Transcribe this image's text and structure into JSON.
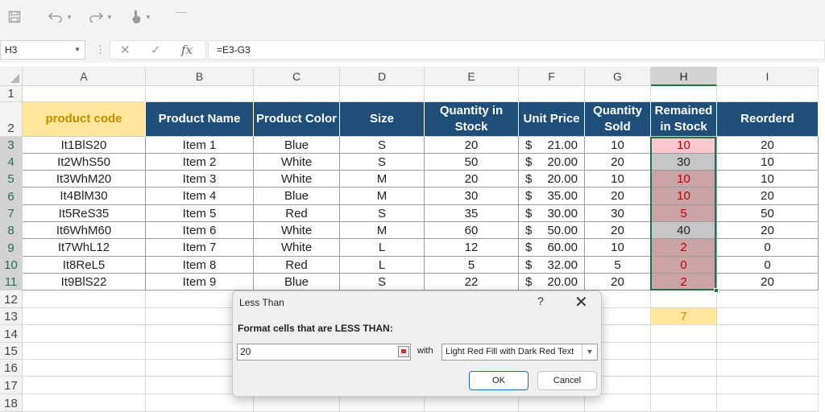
{
  "toolbar": {
    "save_icon": "floppy-disk-icon",
    "undo_icon": "undo-icon",
    "redo_icon": "redo-icon",
    "touch_icon": "touch-mode-icon"
  },
  "formula_bar": {
    "name_box": "H3",
    "formula": "=E3-G3",
    "fx_label": "fx"
  },
  "columns": [
    "A",
    "B",
    "C",
    "D",
    "E",
    "F",
    "G",
    "H",
    "I"
  ],
  "selected_column": "H",
  "rows": [
    "1",
    "2",
    "3",
    "4",
    "5",
    "6",
    "7",
    "8",
    "9",
    "10",
    "11",
    "12",
    "13",
    "14",
    "15",
    "16",
    "17",
    "18"
  ],
  "table": {
    "headers": [
      "product code",
      "Product Name",
      "Product Color",
      "Size",
      "Quantity in Stock",
      "Unit Price",
      "Quantity Sold",
      "Remained in Stock",
      "Reorderd"
    ],
    "rows": [
      [
        "It1BlS20",
        "Item 1",
        "Blue",
        "S",
        "20",
        "$",
        "21.00",
        "10",
        "10",
        "20"
      ],
      [
        "It2WhS50",
        "Item 2",
        "White",
        "S",
        "50",
        "$",
        "20.00",
        "20",
        "30",
        "10"
      ],
      [
        "It3WhM20",
        "Item 3",
        "White",
        "M",
        "20",
        "$",
        "20.00",
        "10",
        "10",
        "10"
      ],
      [
        "It4BlM30",
        "Item 4",
        "Blue",
        "M",
        "30",
        "$",
        "35.00",
        "20",
        "10",
        "20"
      ],
      [
        "It5ReS35",
        "Item 5",
        "Red",
        "S",
        "35",
        "$",
        "30.00",
        "30",
        "5",
        "50"
      ],
      [
        "It6WhM60",
        "Item 6",
        "White",
        "M",
        "60",
        "$",
        "50.00",
        "20",
        "40",
        "20"
      ],
      [
        "It7WhL12",
        "Item 7",
        "White",
        "L",
        "12",
        "$",
        "60.00",
        "10",
        "2",
        "0"
      ],
      [
        "It8ReL5",
        "Item 8",
        "Red",
        "L",
        "5",
        "$",
        "32.00",
        "5",
        "0",
        "0"
      ],
      [
        "It9BlS22",
        "Item 9",
        "Blue",
        "S",
        "22",
        "$",
        "20.00",
        "20",
        "2",
        "20"
      ]
    ],
    "h13_value": "7"
  },
  "dialog": {
    "title": "Less Than",
    "help": "?",
    "close": "✕",
    "prompt": "Format cells that are LESS THAN:",
    "input_value": "20",
    "with_label": "with",
    "format_selected": "Light Red Fill with Dark Red Text",
    "ok_label": "OK",
    "cancel_label": "Cancel"
  },
  "colors": {
    "header_fill": "#1f4e79",
    "product_code_fill": "#ffe699",
    "light_red_fill": "#ffc7ce",
    "dark_red_text": "#c00000",
    "selection_green": "#217346"
  }
}
